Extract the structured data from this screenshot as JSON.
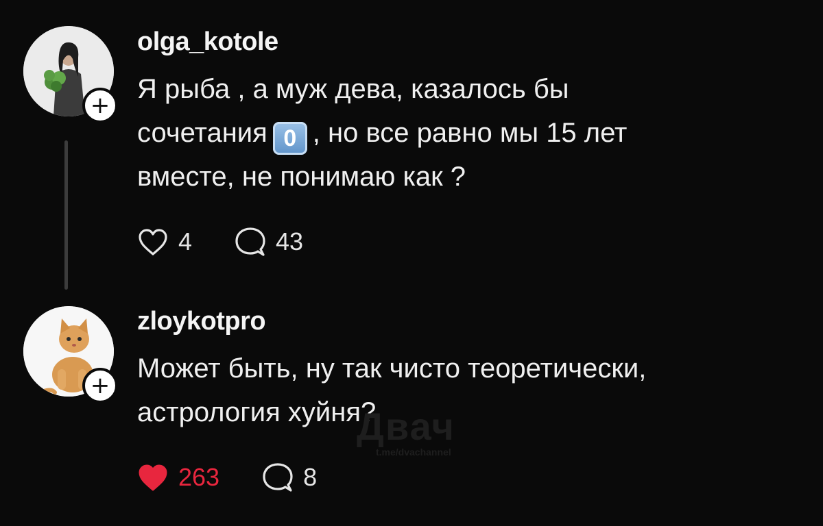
{
  "posts": [
    {
      "username": "olga_kotole",
      "text_line1": "Я рыба , а муж дева, казалось бы",
      "text_line2_before": "сочетания",
      "keycap": "0",
      "text_line2_after": ", но все равно мы 15 лет",
      "text_line3": "вместе, не понимаю как ?",
      "likes": "4",
      "liked": false,
      "replies": "43",
      "avatar_icon": "woman-holding-plant-photo"
    },
    {
      "username": "zloykotpro",
      "text_line1": "Может быть, ну так чисто теоретически,",
      "text_line2": "астрология хуйня?",
      "likes": "263",
      "liked": true,
      "replies": "8",
      "avatar_icon": "ginger-cat-photo"
    }
  ],
  "follow_symbol": "+",
  "watermark": {
    "title": "Двач",
    "subtitle": "t.me/dvachannel"
  },
  "colors": {
    "background": "#0a0a0a",
    "text": "#f0f0f0",
    "like_active": "#e8263e",
    "thread_line": "#3c3c3c"
  },
  "icons": [
    "heart-outline-icon",
    "comment-bubble-icon",
    "heart-filled-icon",
    "plus-icon"
  ]
}
